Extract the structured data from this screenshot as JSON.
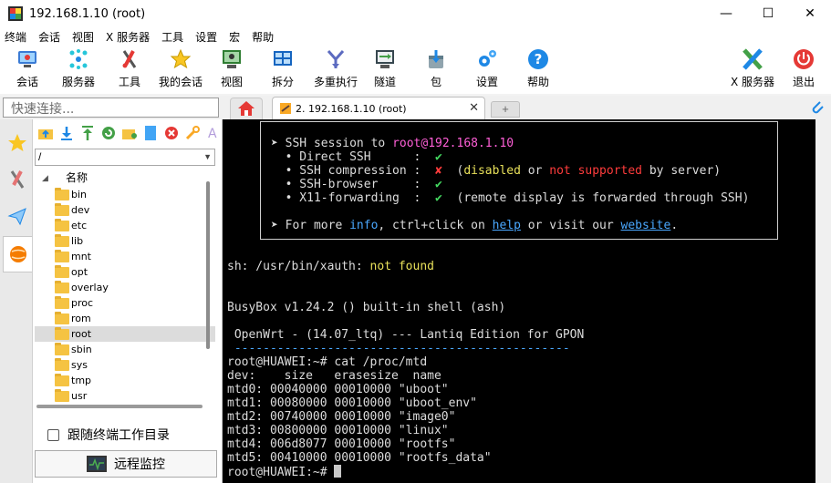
{
  "window": {
    "title": "192.168.1.10 (root)",
    "minimize": "—",
    "maximize": "☐",
    "close": "✕"
  },
  "menu": [
    "终端",
    "会话",
    "视图",
    "X 服务器",
    "工具",
    "设置",
    "宏",
    "帮助"
  ],
  "toolbar": [
    {
      "label": "会话",
      "icon": "session-icon"
    },
    {
      "label": "服务器",
      "icon": "servers-icon"
    },
    {
      "label": "工具",
      "icon": "tools-icon"
    },
    {
      "label": "我的会话",
      "icon": "star-icon"
    },
    {
      "label": "视图",
      "icon": "view-icon"
    },
    {
      "label": "拆分",
      "icon": "split-icon"
    },
    {
      "label": "多重执行",
      "icon": "multiexec-icon"
    },
    {
      "label": "隧道",
      "icon": "tunnel-icon"
    },
    {
      "label": "包",
      "icon": "packages-icon"
    },
    {
      "label": "设置",
      "icon": "settings-icon"
    },
    {
      "label": "帮助",
      "icon": "help-icon"
    },
    {
      "label": "X 服务器",
      "icon": "xserver-icon"
    },
    {
      "label": "退出",
      "icon": "exit-icon"
    }
  ],
  "quick_connect": {
    "placeholder": "快速连接..."
  },
  "tabs": {
    "session_tab": "2. 192.168.1.10 (root)",
    "close": "✕",
    "new_tab": "+"
  },
  "sftp": {
    "path": "/",
    "header": "名称",
    "folders": [
      "bin",
      "dev",
      "etc",
      "lib",
      "mnt",
      "opt",
      "overlay",
      "proc",
      "rom",
      "root",
      "sbin",
      "sys",
      "tmp",
      "usr"
    ],
    "selected": "root",
    "follow_label": "跟随终端工作目录",
    "monitor_label": "远程监控"
  },
  "terminal": {
    "box": {
      "session_prefix": "➤ SSH session to ",
      "session_target": "root@192.168.1.10",
      "direct_ssh": "  • Direct SSH      :  ",
      "compression": "  • SSH compression :  ",
      "browser": "  • SSH-browser     :  ",
      "x11": "  • X11-forwarding  :  ",
      "check": "✔",
      "cross": "✘",
      "comp_open": "  (",
      "disabled": "disabled",
      "or": " or ",
      "not_supported": "not supported",
      "by_server": " by server)",
      "x11_note": "  (remote display is forwarded through SSH)",
      "more_prefix": "➤ For more ",
      "info": "info",
      "more_mid": ", ctrl+click on ",
      "help": "help",
      "more_mid2": " or visit our ",
      "website": "website",
      "more_end": "."
    },
    "xauth_prefix": "sh: /usr/bin/xauth: ",
    "xauth_notfound": "not found",
    "busybox": "BusyBox v1.24.2 () built-in shell (ash)",
    "openwrt": " OpenWrt - (14.07_ltq) --- Lantiq Edition for GPON",
    "dashes": " -----------------------------------------------",
    "lines": [
      "root@HUAWEI:~# cat /proc/mtd",
      "dev:    size   erasesize  name",
      "mtd0: 00040000 00010000 \"uboot\"",
      "mtd1: 00080000 00010000 \"uboot_env\"",
      "mtd2: 00740000 00010000 \"image0\"",
      "mtd3: 00800000 00010000 \"linux\"",
      "mtd4: 006d8077 00010000 \"rootfs\"",
      "mtd5: 00410000 00010000 \"rootfs_data\""
    ],
    "prompt": "root@HUAWEI:~# "
  }
}
